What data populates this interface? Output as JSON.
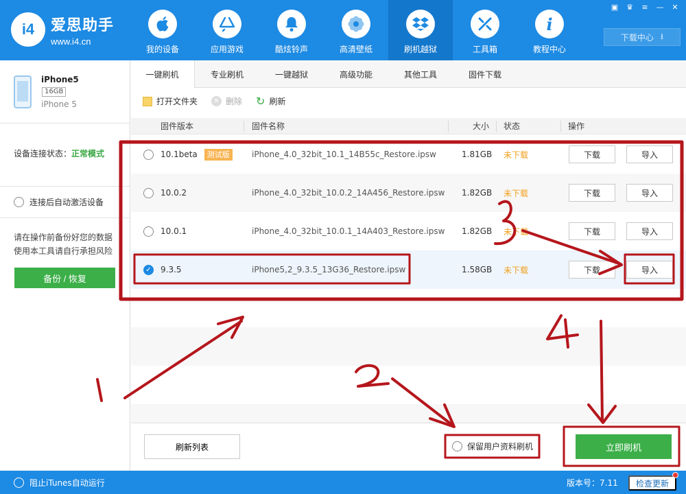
{
  "app": {
    "name": "爱思助手",
    "url": "www.i4.cn",
    "logo_mark": "i4"
  },
  "nav": [
    {
      "label": "我的设备",
      "icon": "apple-icon"
    },
    {
      "label": "应用游戏",
      "icon": "app-store-icon"
    },
    {
      "label": "酷炫铃声",
      "icon": "bell-icon"
    },
    {
      "label": "高清壁纸",
      "icon": "flower-icon"
    },
    {
      "label": "刷机越狱",
      "icon": "dropbox-icon"
    },
    {
      "label": "工具箱",
      "icon": "tools-icon"
    },
    {
      "label": "教程中心",
      "icon": "info-icon"
    }
  ],
  "download_center": "下载中心",
  "device": {
    "name": "iPhone5",
    "capacity": "16GB",
    "model": "iPhone 5",
    "conn_label": "设备连接状态：",
    "conn_status": "正常模式",
    "auto_activate": "连接后自动激活设备",
    "warning_line1": "请在操作前备份好您的数据",
    "warning_line2": "使用本工具请自行承担风险",
    "backup_label": "备份 / 恢复"
  },
  "tabs": [
    "一键刷机",
    "专业刷机",
    "一键越狱",
    "高级功能",
    "其他工具",
    "固件下载"
  ],
  "toolbar": {
    "open_folder": "打开文件夹",
    "delete": "删除",
    "refresh": "刷新"
  },
  "table": {
    "headers": {
      "version": "固件版本",
      "name": "固件名称",
      "size": "大小",
      "status": "状态",
      "ops": "操作"
    },
    "rows": [
      {
        "version": "10.1beta",
        "badge": "测试版",
        "name": "iPhone_4.0_32bit_10.1_14B55c_Restore.ipsw",
        "size": "1.81GB",
        "status": "未下载",
        "download": "下载",
        "import": "导入"
      },
      {
        "version": "10.0.2",
        "badge": "",
        "name": "iPhone_4.0_32bit_10.0.2_14A456_Restore.ipsw",
        "size": "1.82GB",
        "status": "未下载",
        "download": "下载",
        "import": "导入"
      },
      {
        "version": "10.0.1",
        "badge": "",
        "name": "iPhone_4.0_32bit_10.0.1_14A403_Restore.ipsw",
        "size": "1.82GB",
        "status": "未下载",
        "download": "下载",
        "import": "导入"
      },
      {
        "version": "9.3.5",
        "badge": "",
        "name": "iPhone5,2_9.3.5_13G36_Restore.ipsw",
        "size": "1.58GB",
        "status": "未下载",
        "download": "下载",
        "import": "导入",
        "selected": true
      }
    ]
  },
  "bottom": {
    "refresh_list": "刷新列表",
    "keep_data": "保留用户资料刷机",
    "flash_now": "立即刷机"
  },
  "statusbar": {
    "block_itunes": "阻止iTunes自动运行",
    "version": "版本号：7.11",
    "check_update": "检查更新"
  },
  "annotations": [
    "1",
    "2",
    "3",
    "4"
  ],
  "colors": {
    "brand": "#1d8ae3",
    "green": "#3caf48",
    "annotation": "#b5161c",
    "status_orange": "#f1a01f"
  }
}
